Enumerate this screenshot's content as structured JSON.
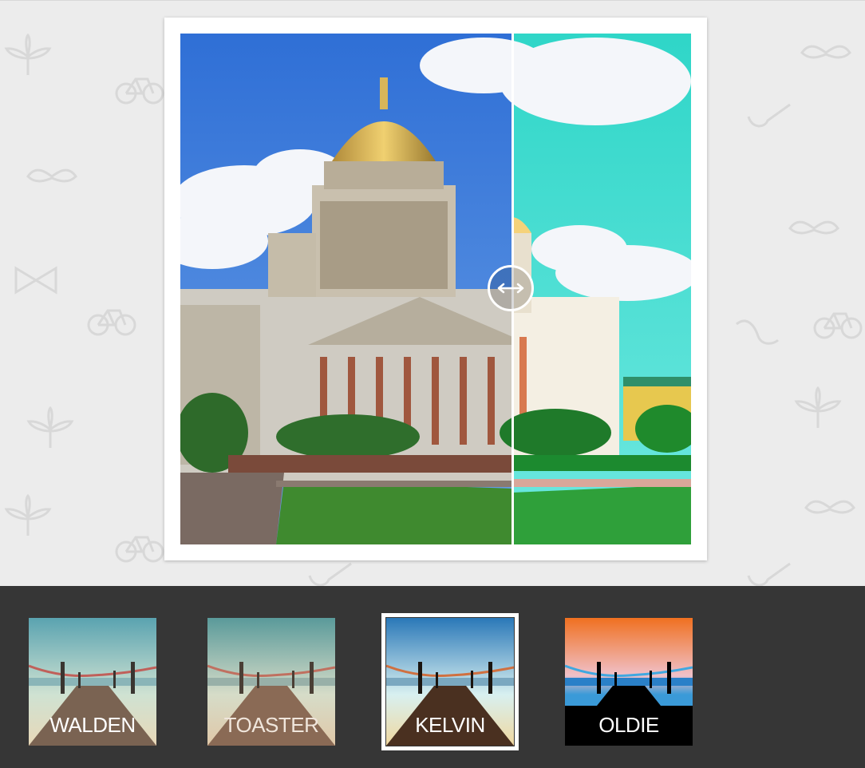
{
  "app": {
    "accent": "#ffffff",
    "bar_color": "#363636"
  },
  "viewer": {
    "handle_icon": "left-right-arrow-icon"
  },
  "filters": [
    {
      "id": "walden",
      "label": "WALDEN",
      "selected": false
    },
    {
      "id": "toaster",
      "label": "TOASTER",
      "selected": false
    },
    {
      "id": "kelvin",
      "label": "KELVIN",
      "selected": true
    },
    {
      "id": "oldie",
      "label": "OLDIE",
      "selected": false
    }
  ]
}
